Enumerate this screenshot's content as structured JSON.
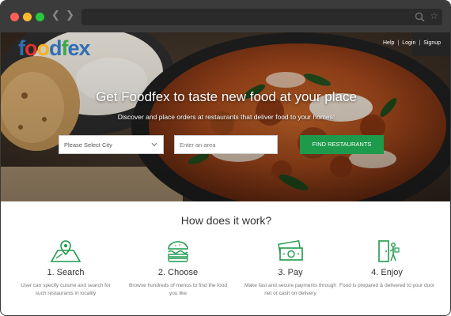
{
  "browser": {
    "back_icon": "chevron-left-icon",
    "forward_icon": "chevron-right-icon",
    "search_icon": "search-icon",
    "star_icon": "star-icon"
  },
  "header": {
    "logo_text": "foodfex",
    "links": [
      "Help",
      "Login",
      "Signup"
    ],
    "separator": "|"
  },
  "hero": {
    "title": "Get Foodfex to taste new food at your place",
    "subtitle": "Discover and place orders at restaurants that deliver food to your homes!",
    "city_select": {
      "value": "Please Select City"
    },
    "area_input": {
      "placeholder": "Enter an area"
    },
    "find_button": "FIND RESTAURANTS"
  },
  "how": {
    "title": "How does it work?",
    "steps": [
      {
        "title": "1. Search",
        "desc": "User can specify cuisine and search for such restaurants in locality",
        "icon": "map-pin-icon"
      },
      {
        "title": "2. Choose",
        "desc": "Browse hundreds of menus to find the food you like",
        "icon": "burger-icon"
      },
      {
        "title": "3. Pay",
        "desc": "Make fast and secure payments through net or cash on delivery",
        "icon": "cash-icon"
      },
      {
        "title": "4. Enjoy",
        "desc": "Food is prepared & delivered to your door",
        "icon": "delivery-door-icon"
      }
    ]
  },
  "colors": {
    "accent_green": "#1d9a4c",
    "chrome_dark": "#3b3b3b",
    "title_text": "#333333"
  }
}
